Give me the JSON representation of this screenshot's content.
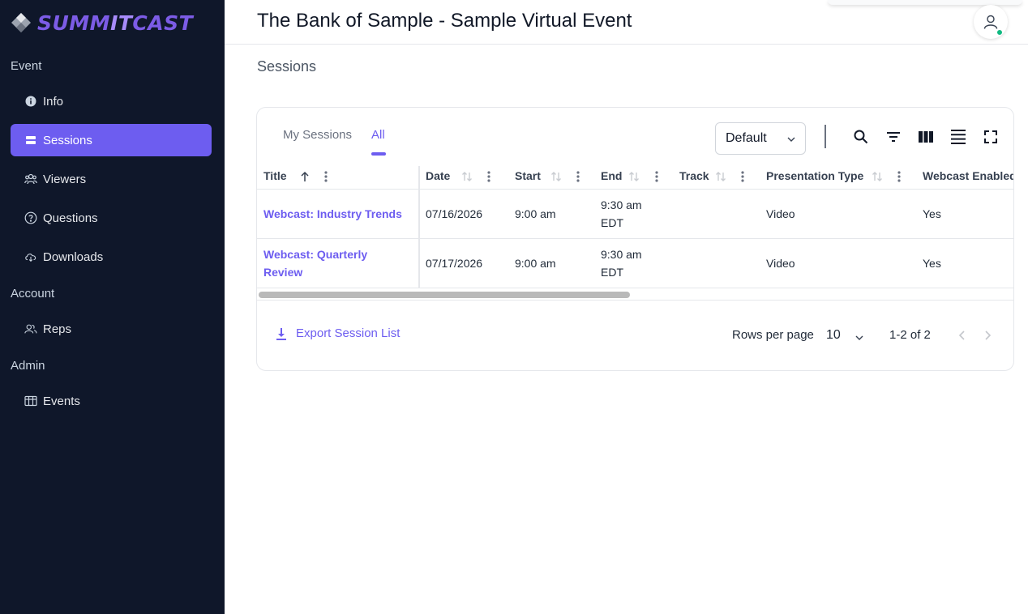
{
  "app": {
    "logo_text_a": "SUMM",
    "logo_text_b": "IT",
    "logo_text_c": "CAST"
  },
  "sidebar": {
    "sections": [
      {
        "label": "Event"
      },
      {
        "label": "Account"
      },
      {
        "label": "Admin"
      }
    ],
    "items": [
      {
        "label": "Info",
        "icon": "info-icon",
        "active": false
      },
      {
        "label": "Sessions",
        "icon": "sessions-icon",
        "active": true
      },
      {
        "label": "Viewers",
        "icon": "users-icon",
        "active": false
      },
      {
        "label": "Questions",
        "icon": "question-icon",
        "active": false
      },
      {
        "label": "Downloads",
        "icon": "cloud-download-icon",
        "active": false
      },
      {
        "label": "Reps",
        "icon": "reps-icon",
        "active": false
      },
      {
        "label": "Events",
        "icon": "table-icon",
        "active": false
      }
    ]
  },
  "header": {
    "title": "The Bank of Sample - Sample Virtual Event"
  },
  "main": {
    "section_title": "Sessions",
    "tabs": [
      {
        "label": "My Sessions",
        "active": false
      },
      {
        "label": "All",
        "active": true
      }
    ],
    "view_select": {
      "value": "Default"
    },
    "table": {
      "columns": [
        "Title",
        "Date",
        "Start",
        "End",
        "Track",
        "Presentation Type",
        "Webcast Enabled"
      ],
      "rows": [
        {
          "title": "Webcast: Industry Trends",
          "date": "07/16/2026",
          "start": "9:00 am",
          "end_line1": "9:30 am",
          "end_line2": "EDT",
          "track": "",
          "presentation_type": "Video",
          "webcast_enabled": "Yes"
        },
        {
          "title_line1": "Webcast: Quarterly",
          "title_line2": "Review",
          "date": "07/17/2026",
          "start": "9:00 am",
          "end_line1": "9:30 am",
          "end_line2": "EDT",
          "track": "",
          "presentation_type": "Video",
          "webcast_enabled": "Yes"
        }
      ]
    },
    "footer": {
      "export_label": "Export Session List",
      "rows_per_page_label": "Rows per page",
      "rows_per_page_value": "10",
      "range_text": "1-2 of 2"
    }
  },
  "colors": {
    "sidebar_bg": "#0f172a",
    "accent": "#6d5df0",
    "status_online": "#10b981"
  }
}
